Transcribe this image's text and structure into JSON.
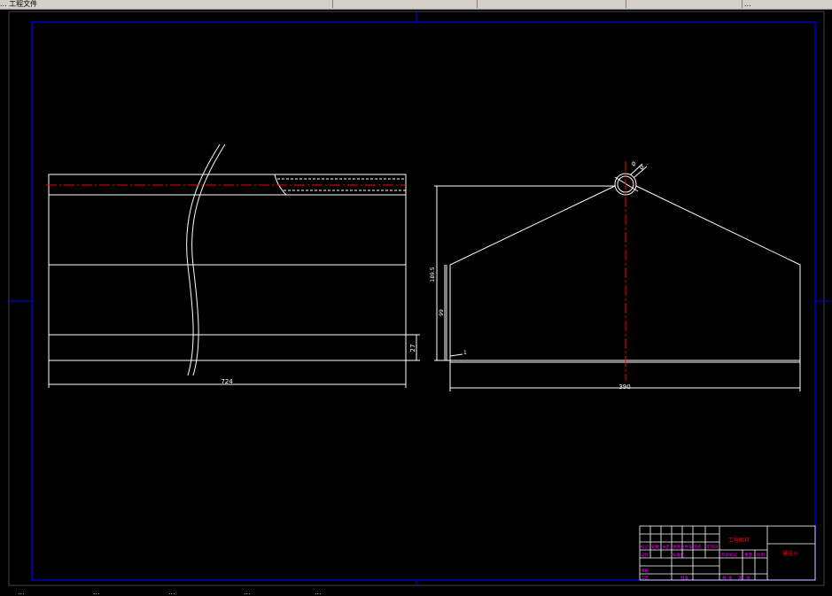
{
  "taskbar": {
    "items": [
      {
        "label": "... 工程文件"
      },
      {
        "label": ""
      },
      {
        "label": ""
      },
      {
        "label": ""
      },
      {
        "label": "..."
      }
    ]
  },
  "drawing": {
    "frame_color": "#0000ff",
    "line_color": "#ffffff",
    "centerline_color": "#ff0000",
    "title_color": "#ff00ff",
    "front_view": {
      "dimension_width": "724",
      "dimension_side": "27"
    },
    "side_view": {
      "dimension_width": "390",
      "dimension_height": "189.5",
      "dimension_lower": "99",
      "dimension_small": "1",
      "hole_labels": [
        "Ø",
        "Ø"
      ]
    },
    "title_block": {
      "title": "工程图样",
      "drawing_number": "输送斗",
      "cells": [
        "标记",
        "处数",
        "分区",
        "更改文件号",
        "签名",
        "年月日",
        "设计",
        "标准化",
        "阶段标记",
        "重量",
        "比例",
        "审核",
        "工艺",
        "批准",
        "共",
        "张",
        "第",
        "张"
      ]
    }
  },
  "bottom": {
    "items": [
      "...",
      "...",
      "...",
      "...",
      "..."
    ]
  }
}
